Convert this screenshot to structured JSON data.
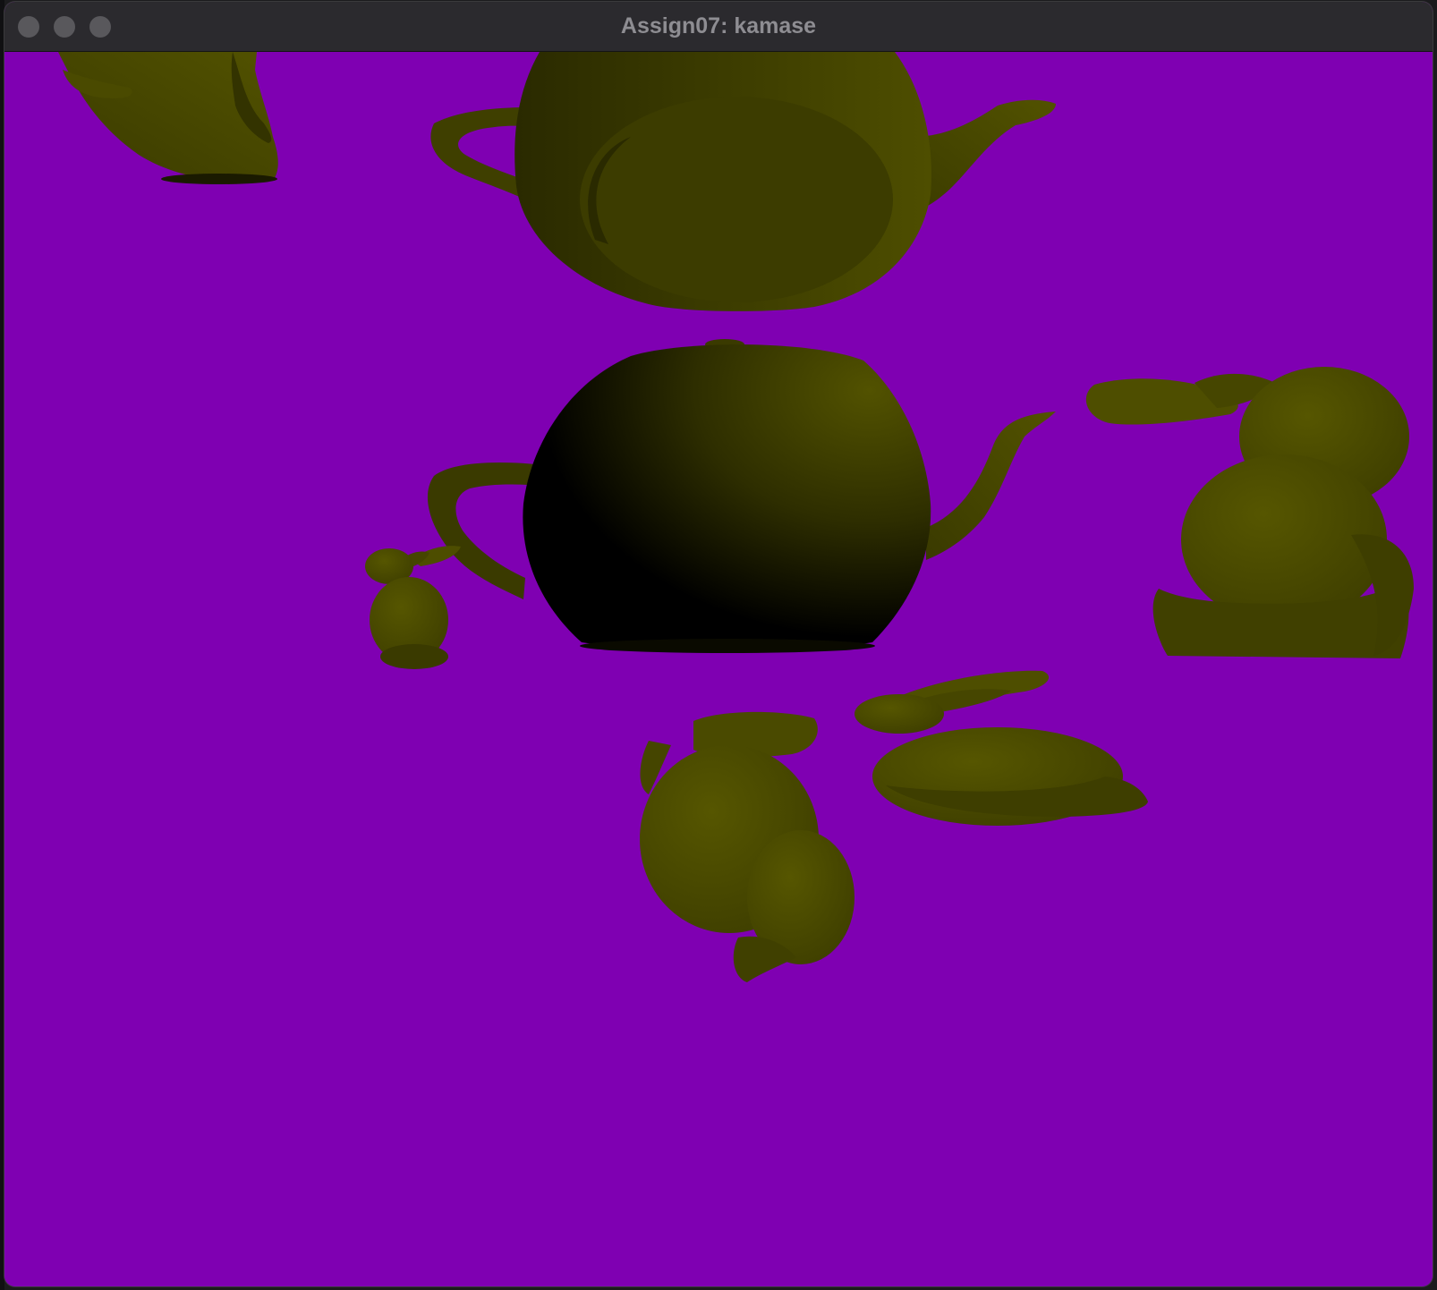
{
  "window": {
    "title": "Assign07: kamase"
  },
  "scene": {
    "background_color": "#7f00b2",
    "object_color": "#4d4d00",
    "shadow_color": "#000000",
    "objects": [
      {
        "kind": "teapot",
        "pose": "tilted-upside-down"
      },
      {
        "kind": "teapot",
        "pose": "upside-down"
      },
      {
        "kind": "teapot",
        "pose": "upright"
      },
      {
        "kind": "bunny",
        "pose": "small-upright"
      },
      {
        "kind": "bunny",
        "pose": "facing-viewer"
      },
      {
        "kind": "bunny",
        "pose": "lying-side"
      },
      {
        "kind": "bunny",
        "pose": "inverted"
      }
    ]
  }
}
